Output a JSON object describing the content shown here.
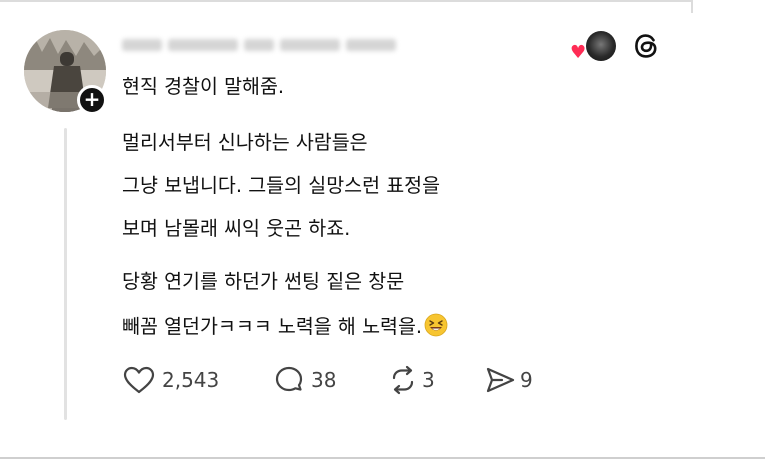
{
  "post": {
    "intro": "현직 경찰이 말해줌.",
    "paragraph1": {
      "line1": "멀리서부터 신나하는 사람들은",
      "line2": "그냥 보냅니다. 그들의 실망스런 표정을",
      "line3": "보며 남몰래 씨익 웃곤 하죠."
    },
    "paragraph2": {
      "line1": "당황 연기를 하던가 썬팅 짙은 창문",
      "line2": "빼꼼 열던가ㅋㅋㅋ 노력을 해 노력을."
    }
  },
  "actions": {
    "likes": "2,543",
    "replies": "38",
    "reposts": "3",
    "shares": "9"
  },
  "icons": {
    "follow": "plus-icon",
    "like": "heart-icon",
    "reply": "speech-bubble-icon",
    "repost": "repost-icon",
    "share": "send-icon",
    "app": "threads-logo-icon",
    "liked_by": "heart-icon",
    "emoji": "laughing-face-icon"
  },
  "colors": {
    "text": "#111111",
    "action_text": "#444444",
    "heart": "#ff2c55",
    "thread_line": "#e2e2e2",
    "emoji_yellow": "#f7c531"
  }
}
